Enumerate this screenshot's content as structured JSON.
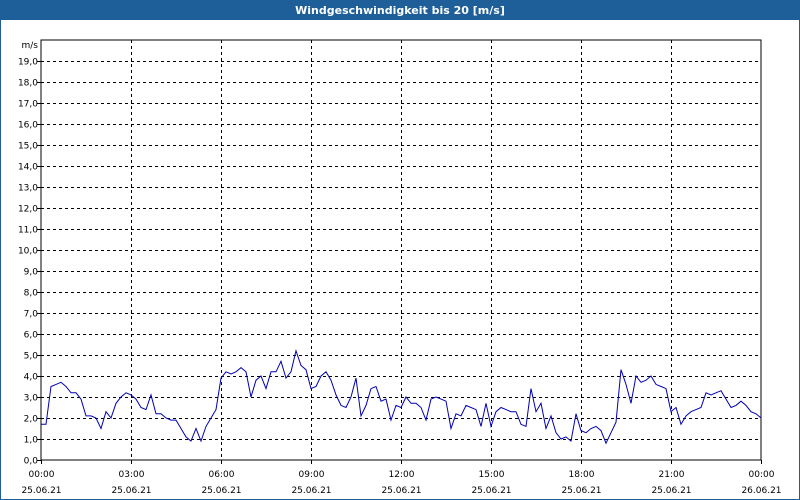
{
  "window": {
    "title": "Windgeschwindigkeit bis 20 [m/s]"
  },
  "colors": {
    "titlebar": "#1f5f99",
    "series": "#0000b4",
    "grid": "#000000"
  },
  "chart_data": {
    "type": "line",
    "title": "Windgeschwindigkeit bis 20 [m/s]",
    "ylabel": "m/s",
    "xlabel": "",
    "ylim": [
      0,
      20
    ],
    "yticks": [
      "0,0",
      "1,0",
      "2,0",
      "3,0",
      "4,0",
      "5,0",
      "6,0",
      "7,0",
      "8,0",
      "9,0",
      "10,0",
      "11,0",
      "12,0",
      "13,0",
      "14,0",
      "15,0",
      "16,0",
      "17,0",
      "18,0",
      "19,0"
    ],
    "xrange": [
      "2021-06-25T00:00",
      "2021-06-26T00:00"
    ],
    "xticks": [
      {
        "time": "00:00",
        "date": "25.06.21"
      },
      {
        "time": "03:00",
        "date": "25.06.21"
      },
      {
        "time": "06:00",
        "date": "25.06.21"
      },
      {
        "time": "09:00",
        "date": "25.06.21"
      },
      {
        "time": "12:00",
        "date": "25.06.21"
      },
      {
        "time": "15:00",
        "date": "25.06.21"
      },
      {
        "time": "18:00",
        "date": "25.06.21"
      },
      {
        "time": "21:00",
        "date": "25.06.21"
      },
      {
        "time": "00:00",
        "date": "26.06.21"
      }
    ],
    "grid": true,
    "series": [
      {
        "values": [
          [
            "2021-06-25T00:00",
            1.7
          ],
          [
            "2021-06-25T00:10",
            1.7
          ],
          [
            "2021-06-25T00:20",
            3.5
          ],
          [
            "2021-06-25T00:30",
            3.6
          ],
          [
            "2021-06-25T00:40",
            3.7
          ],
          [
            "2021-06-25T00:50",
            3.5
          ],
          [
            "2021-06-25T01:00",
            3.2
          ],
          [
            "2021-06-25T01:10",
            3.2
          ],
          [
            "2021-06-25T01:20",
            2.9
          ],
          [
            "2021-06-25T01:30",
            2.1
          ],
          [
            "2021-06-25T01:40",
            2.1
          ],
          [
            "2021-06-25T01:50",
            2.0
          ],
          [
            "2021-06-25T02:00",
            1.5
          ],
          [
            "2021-06-25T02:10",
            2.3
          ],
          [
            "2021-06-25T02:20",
            2.0
          ],
          [
            "2021-06-25T02:30",
            2.7
          ],
          [
            "2021-06-25T02:40",
            3.0
          ],
          [
            "2021-06-25T02:50",
            3.2
          ],
          [
            "2021-06-25T03:00",
            3.1
          ],
          [
            "2021-06-25T03:10",
            2.9
          ],
          [
            "2021-06-25T03:20",
            2.5
          ],
          [
            "2021-06-25T03:30",
            2.4
          ],
          [
            "2021-06-25T03:40",
            3.1
          ],
          [
            "2021-06-25T03:50",
            2.2
          ],
          [
            "2021-06-25T04:00",
            2.2
          ],
          [
            "2021-06-25T04:10",
            2.0
          ],
          [
            "2021-06-25T04:20",
            1.9
          ],
          [
            "2021-06-25T04:30",
            1.9
          ],
          [
            "2021-06-25T04:40",
            1.5
          ],
          [
            "2021-06-25T04:50",
            1.1
          ],
          [
            "2021-06-25T05:00",
            0.9
          ],
          [
            "2021-06-25T05:10",
            1.5
          ],
          [
            "2021-06-25T05:20",
            0.9
          ],
          [
            "2021-06-25T05:30",
            1.6
          ],
          [
            "2021-06-25T05:40",
            2.0
          ],
          [
            "2021-06-25T05:50",
            2.4
          ],
          [
            "2021-06-25T06:00",
            3.9
          ],
          [
            "2021-06-25T06:10",
            4.2
          ],
          [
            "2021-06-25T06:20",
            4.1
          ],
          [
            "2021-06-25T06:30",
            4.2
          ],
          [
            "2021-06-25T06:40",
            4.4
          ],
          [
            "2021-06-25T06:50",
            4.2
          ],
          [
            "2021-06-25T07:00",
            3.0
          ],
          [
            "2021-06-25T07:10",
            3.8
          ],
          [
            "2021-06-25T07:20",
            4.0
          ],
          [
            "2021-06-25T07:30",
            3.4
          ],
          [
            "2021-06-25T07:40",
            4.2
          ],
          [
            "2021-06-25T07:50",
            4.2
          ],
          [
            "2021-06-25T08:00",
            4.7
          ],
          [
            "2021-06-25T08:10",
            3.9
          ],
          [
            "2021-06-25T08:20",
            4.2
          ],
          [
            "2021-06-25T08:30",
            5.2
          ],
          [
            "2021-06-25T08:40",
            4.5
          ],
          [
            "2021-06-25T08:50",
            4.3
          ],
          [
            "2021-06-25T09:00",
            3.4
          ],
          [
            "2021-06-25T09:10",
            3.5
          ],
          [
            "2021-06-25T09:20",
            4.0
          ],
          [
            "2021-06-25T09:30",
            4.2
          ],
          [
            "2021-06-25T09:40",
            3.8
          ],
          [
            "2021-06-25T09:50",
            3.1
          ],
          [
            "2021-06-25T10:00",
            2.6
          ],
          [
            "2021-06-25T10:10",
            2.5
          ],
          [
            "2021-06-25T10:20",
            3.0
          ],
          [
            "2021-06-25T10:30",
            3.9
          ],
          [
            "2021-06-25T10:40",
            2.1
          ],
          [
            "2021-06-25T10:50",
            2.6
          ],
          [
            "2021-06-25T11:00",
            3.4
          ],
          [
            "2021-06-25T11:10",
            3.5
          ],
          [
            "2021-06-25T11:20",
            2.8
          ],
          [
            "2021-06-25T11:30",
            2.9
          ],
          [
            "2021-06-25T11:40",
            1.9
          ],
          [
            "2021-06-25T11:50",
            2.6
          ],
          [
            "2021-06-25T12:00",
            2.5
          ],
          [
            "2021-06-25T12:10",
            3.0
          ],
          [
            "2021-06-25T12:20",
            2.7
          ],
          [
            "2021-06-25T12:30",
            2.7
          ],
          [
            "2021-06-25T12:40",
            2.5
          ],
          [
            "2021-06-25T12:50",
            1.9
          ],
          [
            "2021-06-25T13:00",
            2.9
          ],
          [
            "2021-06-25T13:10",
            3.0
          ],
          [
            "2021-06-25T13:20",
            2.9
          ],
          [
            "2021-06-25T13:30",
            2.8
          ],
          [
            "2021-06-25T13:40",
            1.5
          ],
          [
            "2021-06-25T13:50",
            2.2
          ],
          [
            "2021-06-25T14:00",
            2.1
          ],
          [
            "2021-06-25T14:10",
            2.6
          ],
          [
            "2021-06-25T14:20",
            2.5
          ],
          [
            "2021-06-25T14:30",
            2.4
          ],
          [
            "2021-06-25T14:40",
            1.6
          ],
          [
            "2021-06-25T14:50",
            2.7
          ],
          [
            "2021-06-25T15:00",
            1.6
          ],
          [
            "2021-06-25T15:10",
            2.3
          ],
          [
            "2021-06-25T15:20",
            2.5
          ],
          [
            "2021-06-25T15:30",
            2.4
          ],
          [
            "2021-06-25T15:40",
            2.3
          ],
          [
            "2021-06-25T15:50",
            2.3
          ],
          [
            "2021-06-25T16:00",
            1.7
          ],
          [
            "2021-06-25T16:10",
            1.6
          ],
          [
            "2021-06-25T16:20",
            3.4
          ],
          [
            "2021-06-25T16:30",
            2.3
          ],
          [
            "2021-06-25T16:40",
            2.7
          ],
          [
            "2021-06-25T16:50",
            1.5
          ],
          [
            "2021-06-25T17:00",
            2.1
          ],
          [
            "2021-06-25T17:10",
            1.3
          ],
          [
            "2021-06-25T17:20",
            1.0
          ],
          [
            "2021-06-25T17:30",
            1.1
          ],
          [
            "2021-06-25T17:40",
            0.9
          ],
          [
            "2021-06-25T17:50",
            2.2
          ],
          [
            "2021-06-25T18:00",
            1.4
          ],
          [
            "2021-06-25T18:10",
            1.3
          ],
          [
            "2021-06-25T18:20",
            1.5
          ],
          [
            "2021-06-25T18:30",
            1.6
          ],
          [
            "2021-06-25T18:40",
            1.4
          ],
          [
            "2021-06-25T18:50",
            0.8
          ],
          [
            "2021-06-25T19:00",
            1.3
          ],
          [
            "2021-06-25T19:10",
            1.8
          ],
          [
            "2021-06-25T19:20",
            4.3
          ],
          [
            "2021-06-25T19:30",
            3.6
          ],
          [
            "2021-06-25T19:40",
            2.7
          ],
          [
            "2021-06-25T19:50",
            4.0
          ],
          [
            "2021-06-25T20:00",
            3.7
          ],
          [
            "2021-06-25T20:10",
            3.8
          ],
          [
            "2021-06-25T20:20",
            4.0
          ],
          [
            "2021-06-25T20:30",
            3.6
          ],
          [
            "2021-06-25T20:40",
            3.5
          ],
          [
            "2021-06-25T20:50",
            3.4
          ],
          [
            "2021-06-25T21:00",
            2.3
          ],
          [
            "2021-06-25T21:10",
            2.5
          ],
          [
            "2021-06-25T21:20",
            1.7
          ],
          [
            "2021-06-25T21:30",
            2.1
          ],
          [
            "2021-06-25T21:40",
            2.3
          ],
          [
            "2021-06-25T21:50",
            2.4
          ],
          [
            "2021-06-25T22:00",
            2.5
          ],
          [
            "2021-06-25T22:10",
            3.2
          ],
          [
            "2021-06-25T22:20",
            3.1
          ],
          [
            "2021-06-25T22:30",
            3.2
          ],
          [
            "2021-06-25T22:40",
            3.3
          ],
          [
            "2021-06-25T22:50",
            2.9
          ],
          [
            "2021-06-25T23:00",
            2.5
          ],
          [
            "2021-06-25T23:10",
            2.6
          ],
          [
            "2021-06-25T23:20",
            2.8
          ],
          [
            "2021-06-25T23:30",
            2.6
          ],
          [
            "2021-06-25T23:40",
            2.3
          ],
          [
            "2021-06-25T23:50",
            2.2
          ],
          [
            "2021-06-26T00:00",
            2.0
          ]
        ]
      }
    ]
  }
}
